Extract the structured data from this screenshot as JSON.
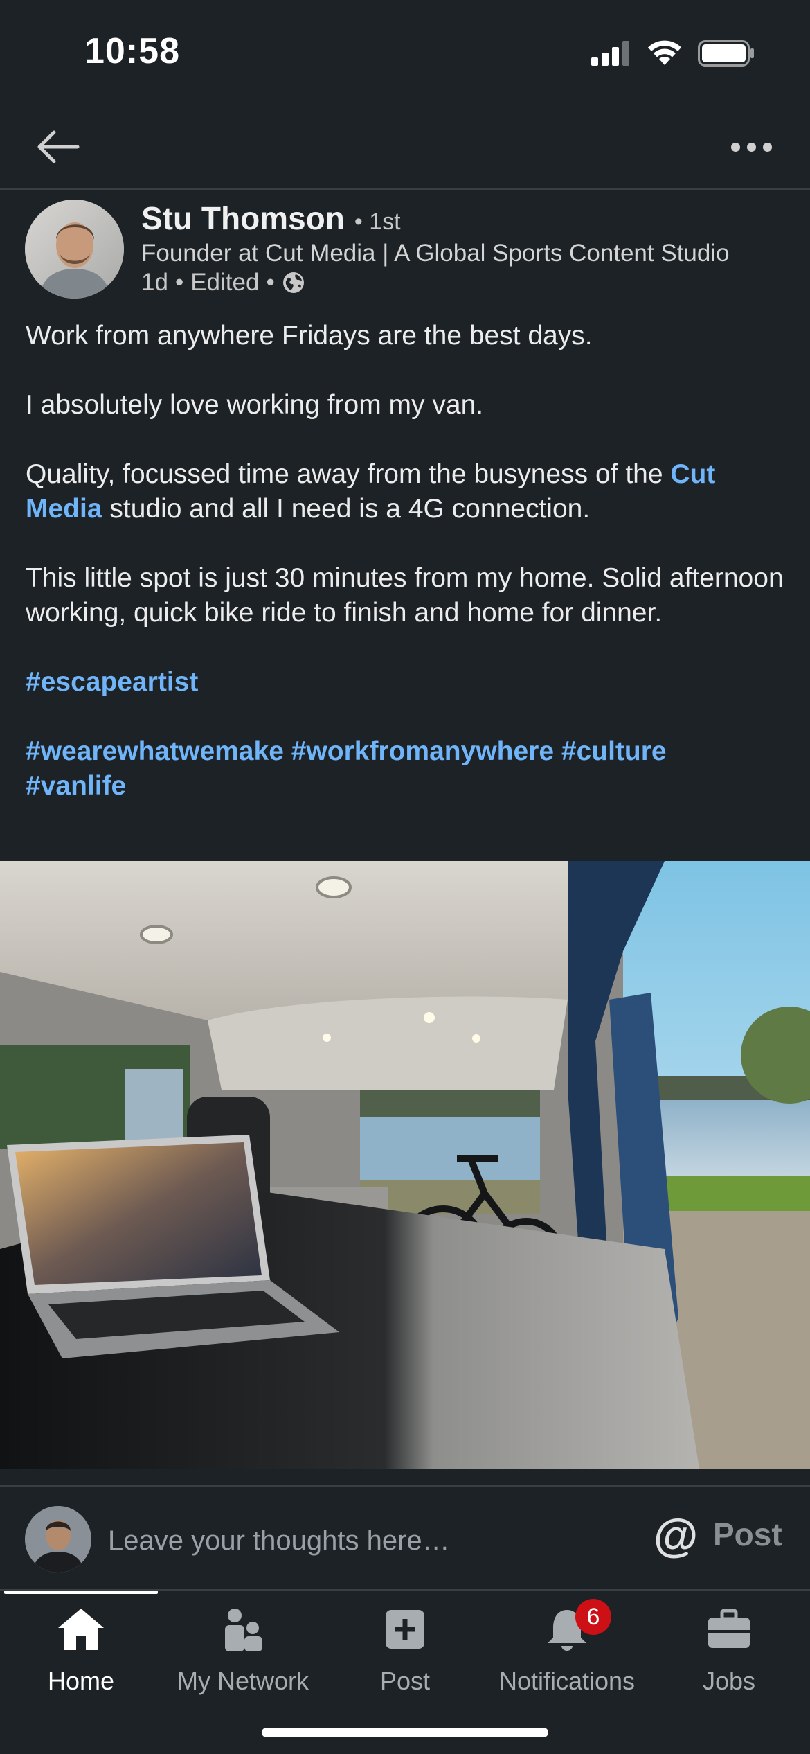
{
  "status_bar": {
    "time": "10:58"
  },
  "nav": {
    "back_icon": "arrow-left-icon",
    "more_icon": "more-horizontal-icon"
  },
  "post": {
    "author": {
      "name": "Stu Thomson",
      "degree": "• 1st",
      "headline": "Founder at Cut Media | A Global Sports Content Studio",
      "time": "1d",
      "edited": "Edited",
      "visibility_icon": "globe-icon"
    },
    "body": {
      "line1": "Work from anywhere Fridays are the best days.",
      "line2": "I absolutely love working from my van.",
      "line3_before": "Quality, focussed time away from the busyness of the ",
      "line3_link": "Cut Media",
      "line3_after": " studio and all I need is a 4G connection.",
      "line4": "This little spot is just 30 minutes from my home. Solid afternoon working, quick bike ride to finish and home for dinner.",
      "hashtag_1": "#escapeartist",
      "hashtags": [
        "#wearewhatwemake",
        "#workfromanywhere",
        "#culture",
        "#vanlife"
      ]
    }
  },
  "comment_bar": {
    "placeholder": "Leave your thoughts here…",
    "mention_label": "@",
    "post_label": "Post"
  },
  "tabs": [
    {
      "label": "Home",
      "icon": "home-icon",
      "active": true
    },
    {
      "label": "My Network",
      "icon": "network-icon",
      "active": false
    },
    {
      "label": "Post",
      "icon": "plus-square-icon",
      "active": false
    },
    {
      "label": "Notifications",
      "icon": "bell-icon",
      "active": false,
      "badge": "6"
    },
    {
      "label": "Jobs",
      "icon": "briefcase-icon",
      "active": false
    }
  ],
  "colors": {
    "background": "#1d2226",
    "link": "#70b5f9",
    "badge": "#cc1016"
  }
}
